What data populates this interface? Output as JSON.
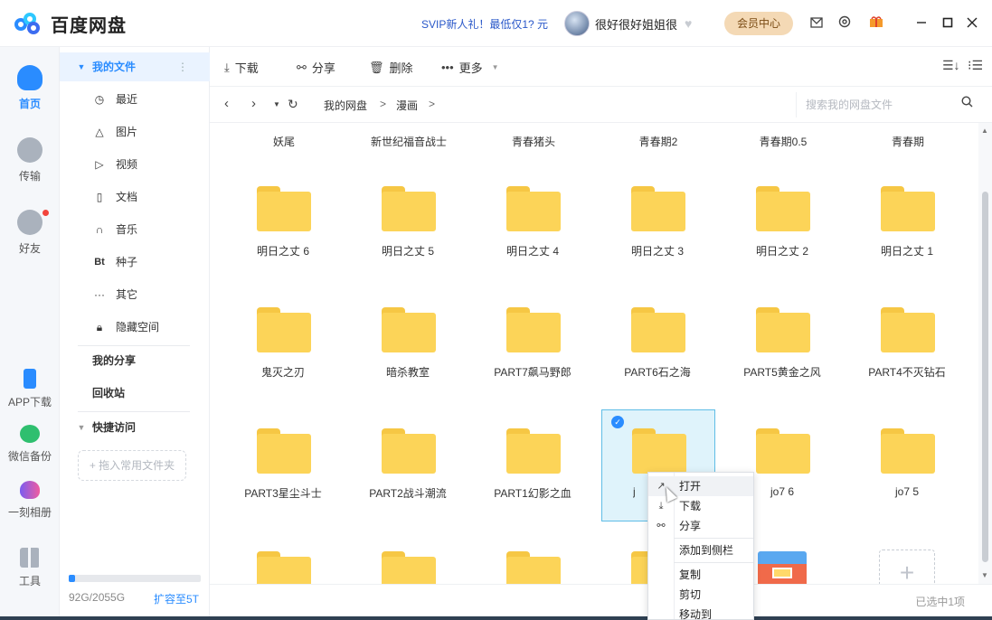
{
  "app": {
    "logo_text": "百度网盘",
    "promo": "SVIP新人礼！最低仅1? 元",
    "user_name": "很好很好姐姐很",
    "member_button": "会员中心",
    "brand_color": "#2a8cff"
  },
  "titlebar_icons": [
    "mail-icon",
    "settings-icon",
    "gift-icon",
    "minimize-icon",
    "maximize-icon",
    "close-icon"
  ],
  "rail": [
    {
      "label": "首页",
      "icon": "cloud-icon",
      "active": true
    },
    {
      "label": "传输",
      "icon": "transfer-icon"
    },
    {
      "label": "好友",
      "icon": "friends-icon"
    },
    {
      "label": "APP下载",
      "icon": "phone-icon"
    },
    {
      "label": "微信备份",
      "icon": "wechat-icon"
    },
    {
      "label": "一刻相册",
      "icon": "album-icon"
    },
    {
      "label": "工具",
      "icon": "tools-icon"
    }
  ],
  "sidebar": {
    "my_files": "我的文件",
    "items": [
      {
        "label": "最近",
        "icon": "clock-icon"
      },
      {
        "label": "图片",
        "icon": "image-icon"
      },
      {
        "label": "视频",
        "icon": "video-icon"
      },
      {
        "label": "文档",
        "icon": "doc-icon"
      },
      {
        "label": "音乐",
        "icon": "music-icon"
      },
      {
        "label": "种子",
        "icon": "bt-icon",
        "glyph": "Bt"
      },
      {
        "label": "其它",
        "icon": "more-icon"
      },
      {
        "label": "隐藏空间",
        "icon": "lock-icon"
      }
    ],
    "my_share": "我的分享",
    "recycle": "回收站",
    "quick_access": "快捷访问",
    "drop_hint": "+ 拖入常用文件夹",
    "storage_text": "92G/2055G",
    "storage_used_fraction": 0.045,
    "expand_link": "扩容至5T"
  },
  "toolbar": {
    "download": "下载",
    "share": "分享",
    "delete": "删除",
    "more": "更多"
  },
  "nav": {
    "crumbs": [
      "我的网盘",
      ">",
      "漫画",
      ">"
    ],
    "search_placeholder": "搜索我的网盘文件"
  },
  "grid": {
    "top_row_labels": [
      "妖尾",
      "新世纪福音战士",
      "青春猪头",
      "青春期2",
      "青春期0.5",
      "青春期"
    ],
    "rows": [
      [
        "明日之丈 6",
        "明日之丈 5",
        "明日之丈 4",
        "明日之丈 3",
        "明日之丈 2",
        "明日之丈 1"
      ],
      [
        "鬼灭之刃",
        "暗杀教室",
        "PART7飙马野郎",
        "PART6石之海",
        "PART5黄金之风",
        "PART4不灭钻石"
      ],
      [
        "PART3星尘斗士",
        "PART2战斗潮流",
        "PART1幻影之血",
        "j",
        "jo7 6",
        "jo7 5"
      ]
    ],
    "selected_label": "j"
  },
  "context_menu": {
    "items": [
      "打开",
      "下载",
      "分享",
      "添加到侧栏",
      "复制",
      "剪切",
      "移动到"
    ]
  },
  "status": {
    "selection": "已选中1项"
  }
}
